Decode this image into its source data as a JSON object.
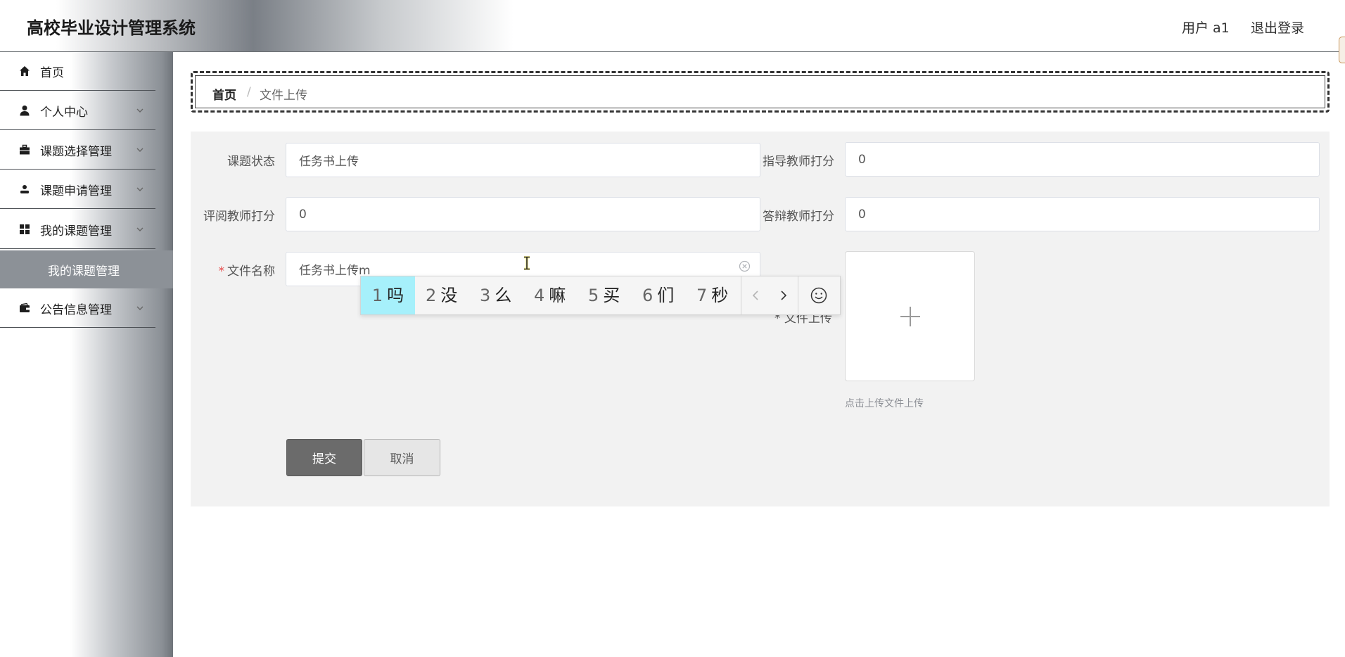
{
  "header": {
    "app_title": "高校毕业设计管理系统",
    "user_label": "用户 a1",
    "logout_label": "退出登录"
  },
  "sidebar": {
    "items": [
      {
        "label": "首页",
        "icon": "home-icon"
      },
      {
        "label": "个人中心",
        "icon": "user-icon"
      },
      {
        "label": "课题选择管理",
        "icon": "briefcase-icon"
      },
      {
        "label": "课题申请管理",
        "icon": "person-icon"
      },
      {
        "label": "我的课题管理",
        "icon": "grid-icon"
      },
      {
        "label": "公告信息管理",
        "icon": "wallet-icon"
      }
    ],
    "active_subitem": "我的课题管理"
  },
  "breadcrumb": {
    "home": "首页",
    "separator": "/",
    "current": "文件上传"
  },
  "form": {
    "topic_status_label": "课题状态",
    "topic_status_value": "任务书上传",
    "advisor_score_label": "指导教师打分",
    "advisor_score_value": "0",
    "reviewer_score_label": "评阅教师打分",
    "reviewer_score_value": "0",
    "defense_score_label": "答辩教师打分",
    "defense_score_value": "0",
    "file_name_required": "*",
    "file_name_label": "文件名称",
    "file_name_value": "任务书上传m",
    "file_upload_label_partial": "* 文件上传",
    "upload_hint": "点击上传文件上传",
    "submit_label": "提交",
    "cancel_label": "取消"
  },
  "ime": {
    "candidates": [
      {
        "num": "1",
        "char": "吗"
      },
      {
        "num": "2",
        "char": "没"
      },
      {
        "num": "3",
        "char": "么"
      },
      {
        "num": "4",
        "char": "嘛"
      },
      {
        "num": "5",
        "char": "买"
      },
      {
        "num": "6",
        "char": "们"
      },
      {
        "num": "7",
        "char": "秒"
      }
    ],
    "active_index": 0
  },
  "colors": {
    "required": "#e84d4d",
    "ime_highlight": "#a6f0fb",
    "submit_bg": "#6b6b6b"
  }
}
